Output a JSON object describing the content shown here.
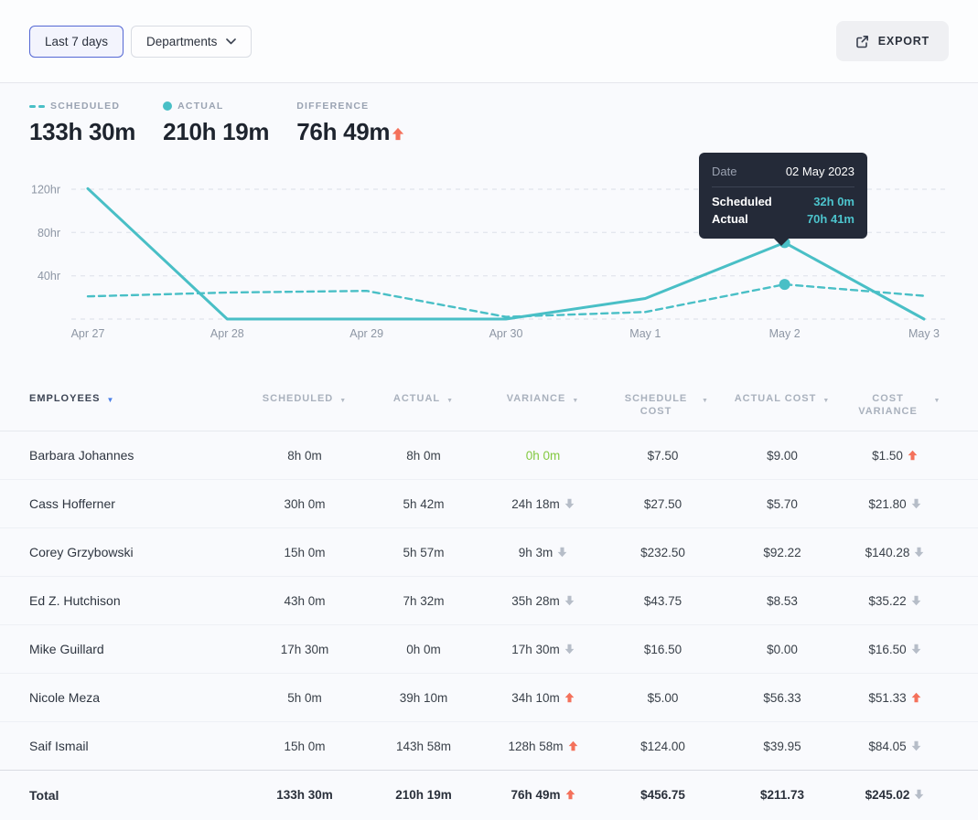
{
  "colors": {
    "accent_teal": "#49bfc6",
    "arrow_up": "#f4715b",
    "arrow_down": "#b6bdc8",
    "positive_green": "#83c941",
    "sort_active_blue": "#4b80e8",
    "tooltip_bg": "#242a38"
  },
  "toolbar": {
    "period_label": "Last 7 days",
    "departments_label": "Departments",
    "export_label": "EXPORT"
  },
  "summary": {
    "scheduled": {
      "label": "SCHEDULED",
      "value": "133h 30m"
    },
    "actual": {
      "label": "ACTUAL",
      "value": "210h 19m"
    },
    "difference": {
      "label": "DIFFERENCE",
      "value": "76h 49m",
      "direction": "up"
    }
  },
  "chart_data": {
    "type": "line",
    "x": [
      "Apr 27",
      "Apr 28",
      "Apr 29",
      "Apr 30",
      "May 1",
      "May 2",
      "May 3"
    ],
    "series": [
      {
        "name": "Scheduled",
        "style": "dashed",
        "values": [
          21,
          24.5,
          26,
          2,
          6.5,
          32,
          21.5
        ]
      },
      {
        "name": "Actual",
        "style": "solid",
        "values": [
          120.6,
          0,
          0,
          0,
          19,
          70.68,
          0
        ]
      }
    ],
    "yticks": [
      {
        "value": 40,
        "label": "40hr"
      },
      {
        "value": 80,
        "label": "80hr"
      },
      {
        "value": 120,
        "label": "120hr"
      }
    ],
    "ylim": [
      0,
      130
    ],
    "grid": true,
    "line_color": "#49bfc6",
    "highlight_index": 5,
    "highlight": {
      "date": "02 May 2023",
      "scheduled": "32h 0m",
      "actual": "70h 41m"
    }
  },
  "tooltip": {
    "date_label": "Date",
    "date_value": "02 May 2023",
    "scheduled_label": "Scheduled",
    "scheduled_value": "32h 0m",
    "actual_label": "Actual",
    "actual_value": "70h 41m"
  },
  "table": {
    "columns": [
      {
        "label": "EMPLOYEES",
        "sort": "active",
        "align": "left"
      },
      {
        "label": "SCHEDULED"
      },
      {
        "label": "ACTUAL"
      },
      {
        "label": "VARIANCE"
      },
      {
        "label": "SCHEDULE COST",
        "wrap": true
      },
      {
        "label": "ACTUAL COST"
      },
      {
        "label": "COST VARIANCE",
        "wrap": true
      }
    ],
    "rows": [
      {
        "name": "Barbara Johannes",
        "scheduled": "8h 0m",
        "actual": "8h 0m",
        "variance": {
          "text": "0h 0m",
          "arrow": "none",
          "tone": "green"
        },
        "schedule_cost": "$7.50",
        "actual_cost": "$9.00",
        "cost_variance": {
          "text": "$1.50",
          "arrow": "up"
        }
      },
      {
        "name": "Cass Hofferner",
        "scheduled": "30h 0m",
        "actual": "5h 42m",
        "variance": {
          "text": "24h 18m",
          "arrow": "down"
        },
        "schedule_cost": "$27.50",
        "actual_cost": "$5.70",
        "cost_variance": {
          "text": "$21.80",
          "arrow": "down"
        }
      },
      {
        "name": "Corey Grzybowski",
        "scheduled": "15h 0m",
        "actual": "5h 57m",
        "variance": {
          "text": "9h 3m",
          "arrow": "down"
        },
        "schedule_cost": "$232.50",
        "actual_cost": "$92.22",
        "cost_variance": {
          "text": "$140.28",
          "arrow": "down"
        }
      },
      {
        "name": "Ed Z. Hutchison",
        "scheduled": "43h 0m",
        "actual": "7h 32m",
        "variance": {
          "text": "35h 28m",
          "arrow": "down"
        },
        "schedule_cost": "$43.75",
        "actual_cost": "$8.53",
        "cost_variance": {
          "text": "$35.22",
          "arrow": "down"
        }
      },
      {
        "name": "Mike Guillard",
        "scheduled": "17h 30m",
        "actual": "0h 0m",
        "variance": {
          "text": "17h 30m",
          "arrow": "down"
        },
        "schedule_cost": "$16.50",
        "actual_cost": "$0.00",
        "cost_variance": {
          "text": "$16.50",
          "arrow": "down"
        }
      },
      {
        "name": "Nicole Meza",
        "scheduled": "5h 0m",
        "actual": "39h 10m",
        "variance": {
          "text": "34h 10m",
          "arrow": "up"
        },
        "schedule_cost": "$5.00",
        "actual_cost": "$56.33",
        "cost_variance": {
          "text": "$51.33",
          "arrow": "up"
        }
      },
      {
        "name": "Saif Ismail",
        "scheduled": "15h 0m",
        "actual": "143h 58m",
        "variance": {
          "text": "128h 58m",
          "arrow": "up"
        },
        "schedule_cost": "$124.00",
        "actual_cost": "$39.95",
        "cost_variance": {
          "text": "$84.05",
          "arrow": "down"
        }
      }
    ],
    "total": {
      "name": "Total",
      "scheduled": "133h 30m",
      "actual": "210h 19m",
      "variance": {
        "text": "76h 49m",
        "arrow": "up"
      },
      "schedule_cost": "$456.75",
      "actual_cost": "$211.73",
      "cost_variance": {
        "text": "$245.02",
        "arrow": "down"
      }
    }
  }
}
